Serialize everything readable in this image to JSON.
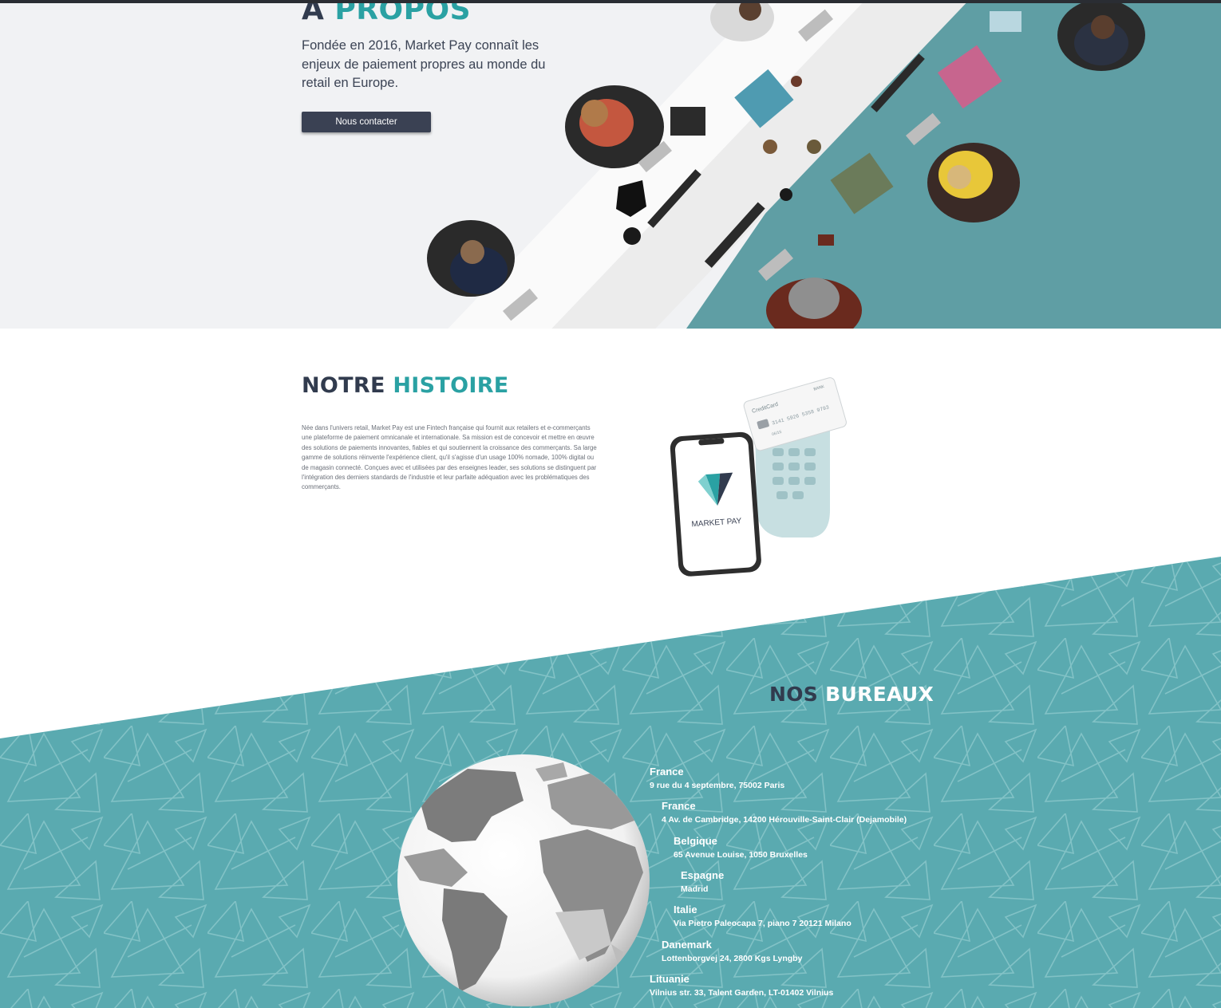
{
  "hero": {
    "title_part1": "À",
    "title_part2": "PROPOS",
    "text": "Fondée en 2016, Market Pay connaît les enjeux de paiement propres au monde du retail en Europe.",
    "button_label": "Nous contacter"
  },
  "histoire": {
    "title_part1": "NOTRE",
    "title_part2": "HISTOIRE",
    "text": "Née dans l'univers retail, Market Pay est une Fintech française qui fournit aux retailers et e-commerçants une plateforme de paiement omnicanale et internationale. Sa mission est de concevoir et mettre en œuvre des solutions de paiements innovantes, fiables et qui soutiennent la croissance des commerçants. Sa large gamme de solutions réinvente l'expérience client, qu'il s'agisse d'un usage 100% nomade, 100% digital ou de magasin connecté. Conçues avec et utilisées par des enseignes leader, ses solutions se distinguent par l'intégration des derniers standards de l'industrie et leur parfaite adéquation avec les problématiques des commerçants.",
    "phone_brand": "MARKET PAY",
    "card_label": "CreditCard",
    "card_bank": "BANK",
    "card_number": "3141 5926 5358 9793",
    "card_expiry": "06/15"
  },
  "bureaux": {
    "title_part1": "NOS",
    "title_part2": "BUREAUX",
    "offices": [
      {
        "country": "France",
        "address": "9 rue du 4 septembre, 75002 Paris"
      },
      {
        "country": "France",
        "address": "4 Av. de Cambridge, 14200 Hérouville-Saint-Clair (Dejamobile)"
      },
      {
        "country": "Belgique",
        "address": "65 Avenue Louise, 1050 Bruxelles"
      },
      {
        "country": "Espagne",
        "address": "Madrid"
      },
      {
        "country": "Italie",
        "address": "Via Pietro Paleocapa 7, piano 7 20121 Milano"
      },
      {
        "country": "Danemark",
        "address": "Lottenborgvej 24, 2800 Kgs Lyngby"
      },
      {
        "country": "Lituanie",
        "address": "Vilnius str. 33, Talent Garden, LT-01402 Vilnius"
      }
    ]
  },
  "colors": {
    "accent": "#2aa1a3",
    "dark": "#313b4e",
    "teal_band": "#5aaab0",
    "button": "#3a4153"
  },
  "icons": [
    "office-photo",
    "phone-illustration",
    "card-terminal-illustration",
    "market-pay-logo-icon",
    "world-globe-icon"
  ]
}
